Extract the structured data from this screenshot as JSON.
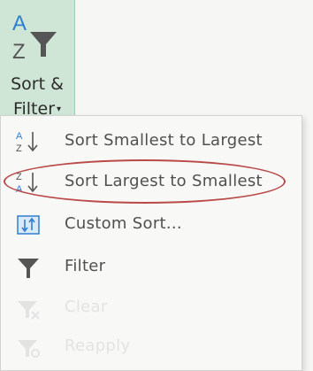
{
  "ribbon": {
    "icon": "az-filter-icon",
    "label_line1": "Sort &",
    "label_line2": "Filter",
    "caret": "▾"
  },
  "menu": {
    "items": [
      {
        "icon": "sort-ascending-icon",
        "label": "Sort Smallest to Largest",
        "enabled": true
      },
      {
        "icon": "sort-descending-icon",
        "label": "Sort Largest to Smallest",
        "enabled": true,
        "annotated": true
      },
      {
        "icon": "custom-sort-icon",
        "label": "Custom Sort...",
        "enabled": true
      },
      {
        "icon": "filter-icon",
        "label": "Filter",
        "enabled": true
      },
      {
        "icon": "clear-filter-icon",
        "label": "Clear",
        "enabled": false
      },
      {
        "icon": "reapply-filter-icon",
        "label": "Reapply",
        "enabled": false
      }
    ]
  },
  "colors": {
    "ribbon_bg": "#cfe6d6",
    "accent_blue": "#2f7fd0",
    "annotation_oval": "#b94a48"
  }
}
